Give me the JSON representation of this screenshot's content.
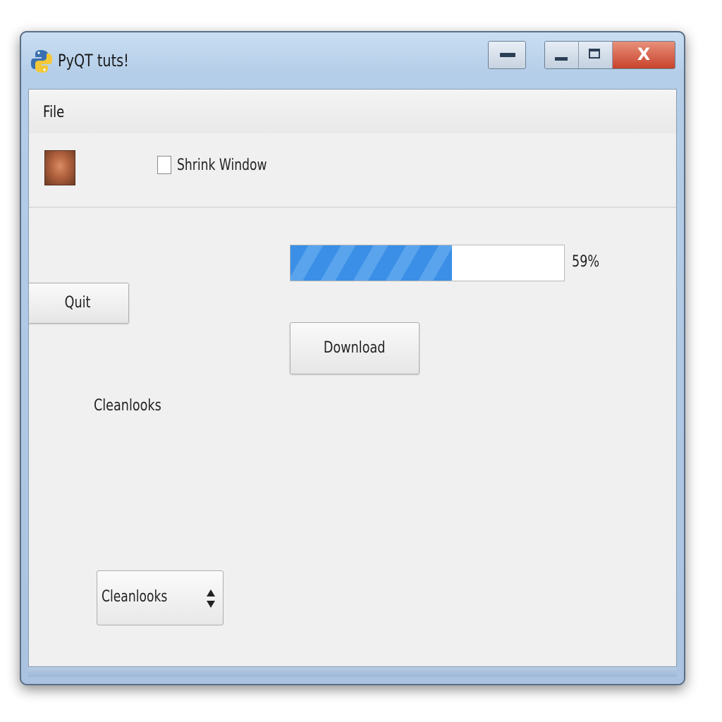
{
  "window": {
    "title": "PyQT tuts!",
    "title_icon": "python-logo-icon",
    "caption_buttons": {
      "extra": "minimize-icon",
      "minimize": "minimize-icon",
      "maximize": "maximize-icon",
      "close_glyph": "X"
    }
  },
  "menubar": {
    "items": [
      {
        "label": "File"
      }
    ]
  },
  "toolbar": {
    "avatar_icon": "face-avatar-icon",
    "checkbox": {
      "label": "Shrink Window",
      "checked": false
    }
  },
  "main": {
    "progress": {
      "value_percent": 59,
      "text": "59%",
      "fill_color": "#3b8fe6"
    },
    "quit_button": {
      "label": "Quit"
    },
    "download_button": {
      "label": "Download"
    },
    "style_label": "Cleanlooks",
    "style_combo": {
      "selected": "Cleanlooks",
      "arrows_icon": "updown-arrows-icon"
    }
  },
  "colors": {
    "close_button": "#c8432c",
    "frame": "#b4cde8",
    "client_bg": "#f0f0f0"
  }
}
